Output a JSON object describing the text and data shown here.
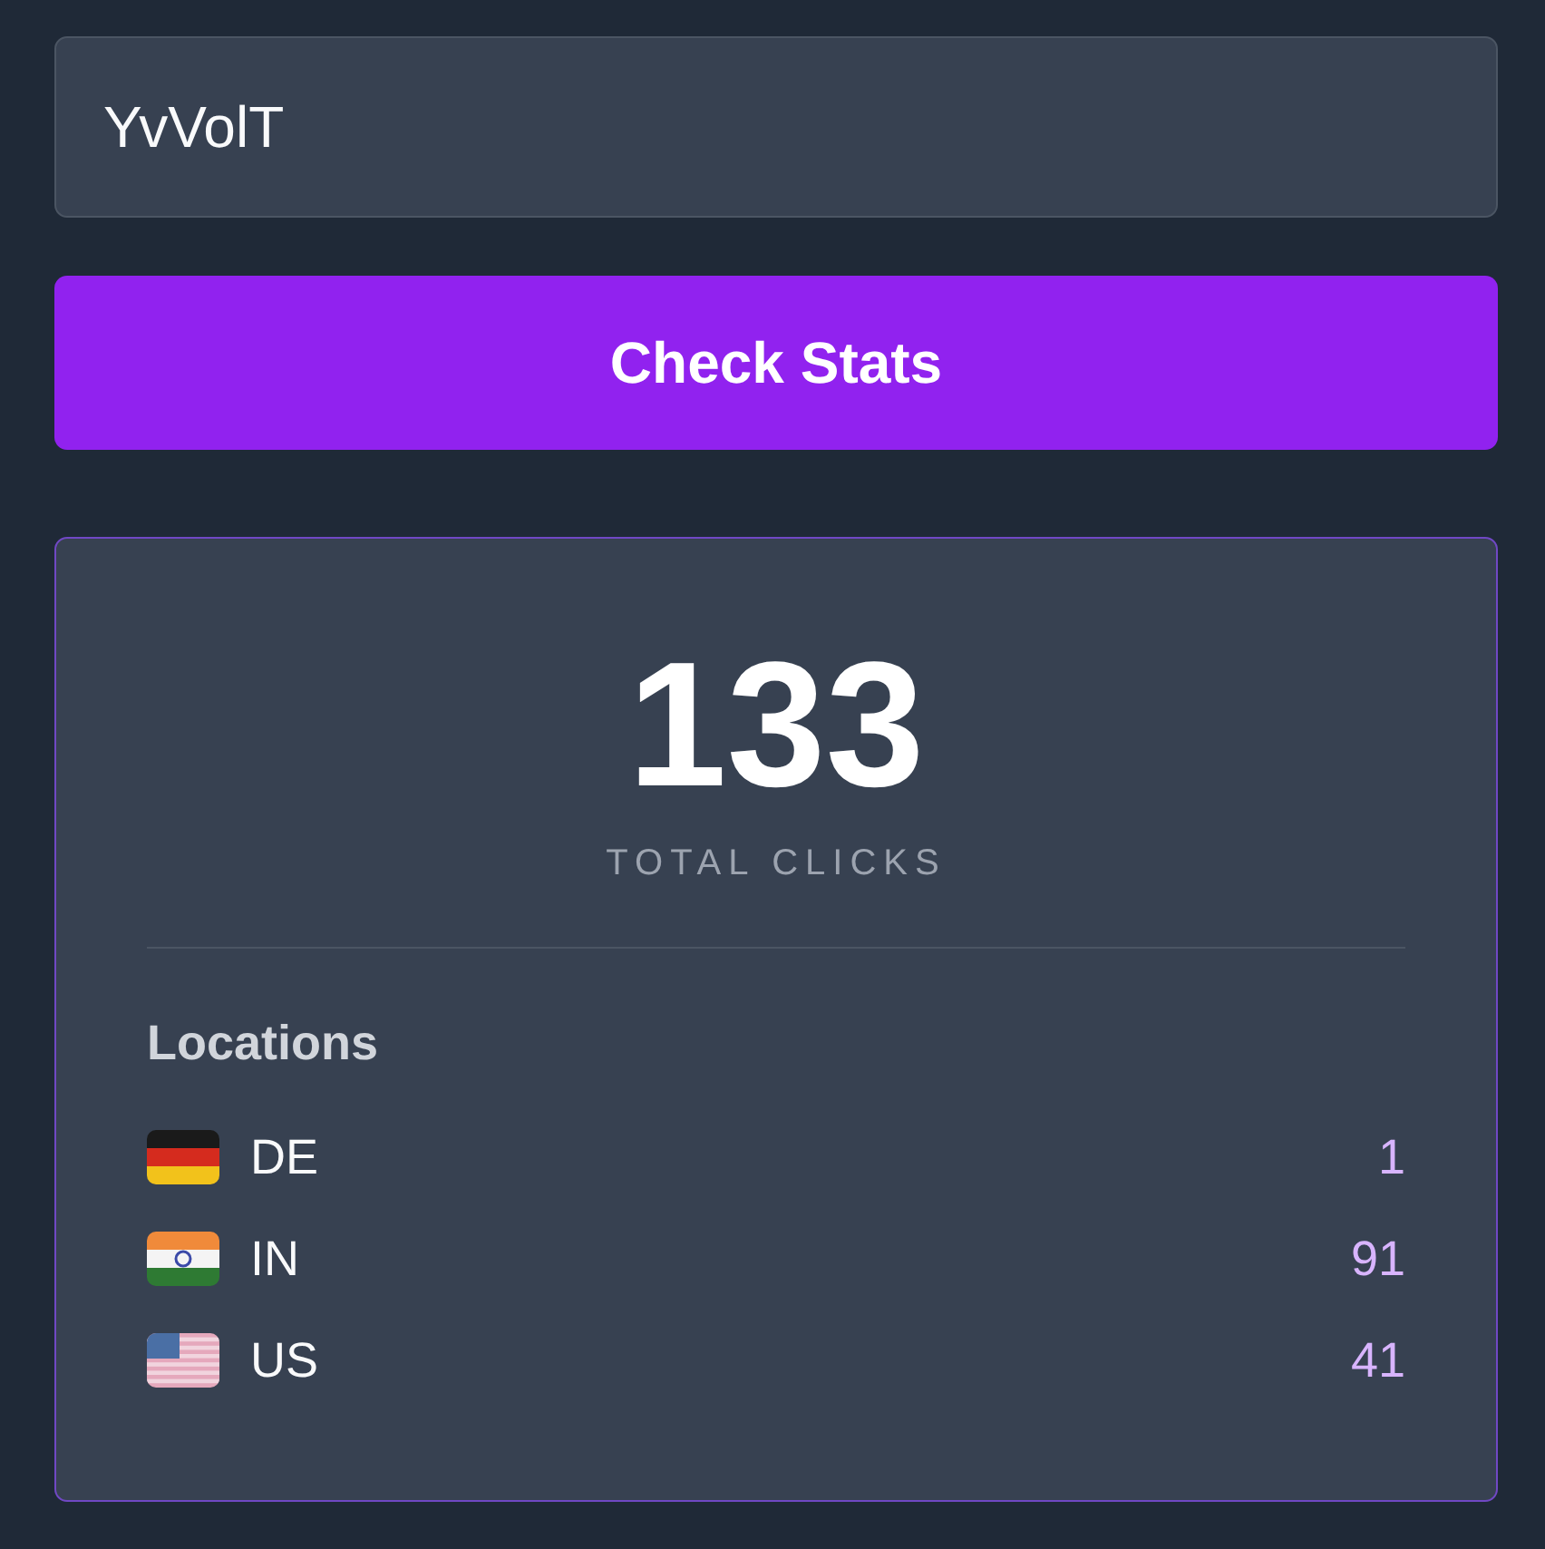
{
  "code_field": {
    "value": "YvVolT"
  },
  "check_button": {
    "label": "Check Stats"
  },
  "stats_card": {
    "total": "133",
    "total_label": "TOTAL CLICKS",
    "locations_heading": "Locations",
    "locations": [
      {
        "kind": "de",
        "code": "DE",
        "clicks": "1"
      },
      {
        "kind": "in",
        "code": "IN",
        "clicks": "91"
      },
      {
        "kind": "us",
        "code": "US",
        "clicks": "41"
      }
    ]
  }
}
